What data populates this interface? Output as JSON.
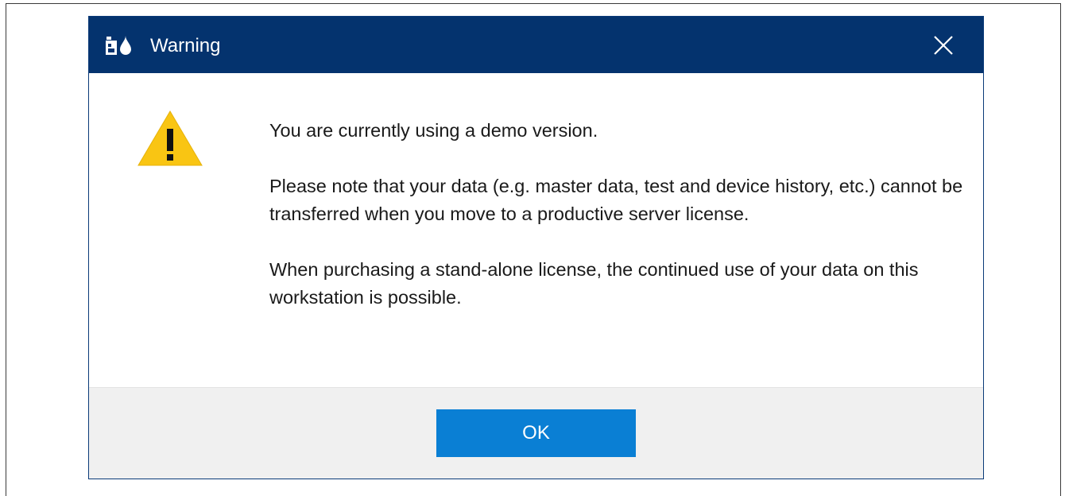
{
  "dialog": {
    "title": "Warning",
    "icon": "app-icon",
    "close_icon": "close-icon",
    "colors": {
      "titlebar": "#04336e",
      "button": "#0a7fd4",
      "footer": "#f0f0f0",
      "warning": "#f9c513"
    }
  },
  "content": {
    "warning_icon": "warning-icon",
    "paragraphs": [
      "You are currently using a demo version.",
      "Please note that your data (e.g. master data, test and device history, etc.) cannot be transferred when you move to a productive server license.",
      "When purchasing a stand-alone license, the continued use of your data on this workstation is possible."
    ]
  },
  "footer": {
    "ok_label": "OK"
  }
}
